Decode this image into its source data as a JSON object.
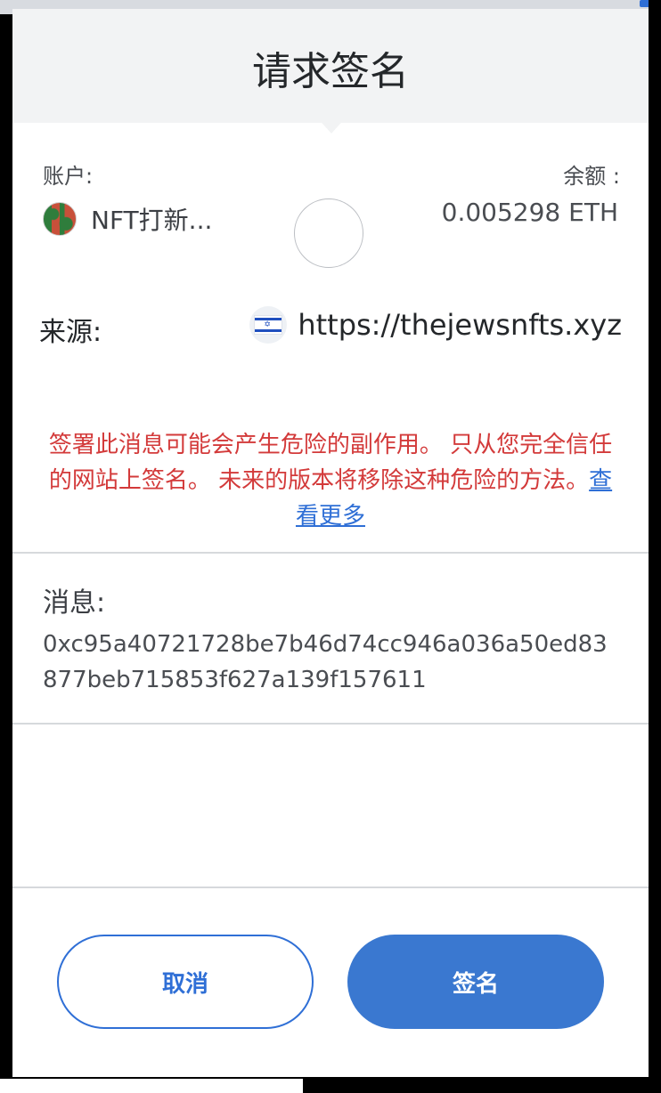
{
  "dialog": {
    "title": "请求签名"
  },
  "account": {
    "label": "账户:",
    "name": "NFT打新..."
  },
  "balance": {
    "label": "余额 :",
    "value": "0.005298 ETH"
  },
  "origin": {
    "label": "来源:",
    "url": "https://thejewsnfts.xyz",
    "favicon": "israel-flag-icon"
  },
  "warning": {
    "text": "签署此消息可能会产生危险的副作用。 只从您完全信任的网站上签名。 未来的版本将移除这种危险的方法。",
    "link_label": "查看更多"
  },
  "message": {
    "label": "消息:",
    "value": "0xc95a40721728be7b46d74cc946a036a50ed83877beb715853f627a139f157611"
  },
  "actions": {
    "cancel_label": "取消",
    "sign_label": "签名"
  },
  "colors": {
    "accent": "#2f6fd6",
    "warning": "#d33a3a",
    "header_bg": "#f2f3f4"
  }
}
